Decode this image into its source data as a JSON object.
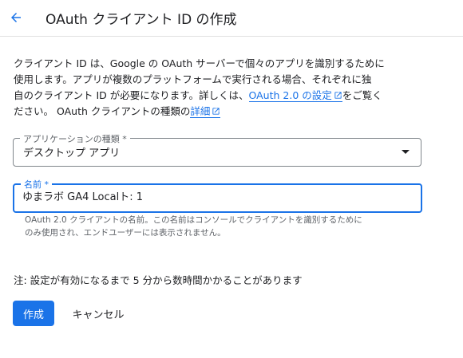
{
  "header": {
    "back_icon": "arrow-back-icon",
    "title": "OAuth クライアント ID の作成"
  },
  "intro": {
    "line1": "クライアント ID は、Google の OAuth サーバーで個々のアプリを識別するために",
    "line2": "使用します。アプリが複数のプラットフォームで実行される場合、それぞれに独",
    "line3_pre": "自のクライアント ID が必要になります。詳しくは、",
    "link_settings": "OAuth 2.0 の設定",
    "line3_post": "をご覧く",
    "line4_pre": "ださい。 OAuth クライアントの種類の",
    "link_details": "詳細",
    "external_icon": "open-in-new-icon"
  },
  "app_type": {
    "label": "アプリケーションの種類 *",
    "value": "デスクトップ アプリ",
    "dropdown_icon": "arrow-drop-down-icon"
  },
  "name_field": {
    "label": "名前 *",
    "value": "ゆまラボ GA4 Localト: 1",
    "hint_line1": "OAuth 2.0 クライアントの名前。この名前はコンソールでクライアントを識別するために",
    "hint_line2": "のみ使用され、エンドユーザーには表示されません。"
  },
  "note": "注: 設定が有効になるまで 5 分から数時間かかることがあります",
  "actions": {
    "create": "作成",
    "cancel": "キャンセル"
  },
  "colors": {
    "accent": "#1a73e8",
    "text": "#202124",
    "secondary_text": "#5f6368"
  }
}
